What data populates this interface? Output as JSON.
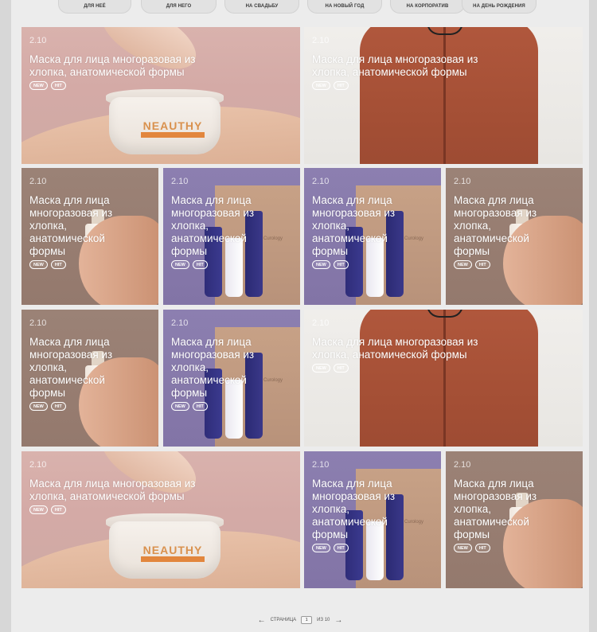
{
  "filters": [
    {
      "label": "ДЛЯ НЕЁ"
    },
    {
      "label": "ДЛЯ НЕГО"
    },
    {
      "label": "НА СВАДЬБУ"
    },
    {
      "label": "НА НОВЫЙ ГОД"
    },
    {
      "label": "НА КОРПОРАТИВ"
    },
    {
      "label": "НА ДЕНЬ РОЖДЕНИЯ"
    }
  ],
  "cards": [
    {
      "date": "2.10",
      "title": "Маска для лица многоразовая из хлопка, анатомической формы",
      "tags": [
        "NEW",
        "HIT"
      ],
      "photo": "jar"
    },
    {
      "date": "2.10",
      "title": "Маска для лица многоразовая из хлопка, анатомической формы",
      "tags": [
        "NEW",
        "HIT"
      ],
      "photo": "shirt"
    },
    {
      "date": "2.10",
      "title": "Маска для лица многоразовая из хлопка, анатомической формы",
      "tags": [
        "NEW",
        "HIT"
      ],
      "photo": "bottle"
    },
    {
      "date": "2.10",
      "title": "Маска для лица многоразовая из хлопка, анатомической формы",
      "tags": [
        "NEW",
        "HIT"
      ],
      "photo": "box"
    },
    {
      "date": "2.10",
      "title": "Маска для лица многоразовая из хлопка, анатомической формы",
      "tags": [
        "NEW",
        "HIT"
      ],
      "photo": "box"
    },
    {
      "date": "2.10",
      "title": "Маска для лица многоразовая из хлопка, анатомической формы",
      "tags": [
        "NEW",
        "HIT"
      ],
      "photo": "bottle"
    },
    {
      "date": "2.10",
      "title": "Маска для лица многоразовая из хлопка, анатомической формы",
      "tags": [
        "NEW",
        "HIT"
      ],
      "photo": "bottle"
    },
    {
      "date": "2.10",
      "title": "Маска для лица многоразовая из хлопка, анатомической формы",
      "tags": [
        "NEW",
        "HIT"
      ],
      "photo": "box"
    },
    {
      "date": "2.10",
      "title": "Маска для лица многоразовая из хлопка, анатомической формы",
      "tags": [
        "NEW",
        "HIT"
      ],
      "photo": "shirt"
    },
    {
      "date": "2.10",
      "title": "Маска для лица многоразовая из хлопка, анатомической формы",
      "tags": [
        "NEW",
        "HIT"
      ],
      "photo": "jar"
    },
    {
      "date": "2.10",
      "title": "Маска для лица многоразовая из хлопка, анатомической формы",
      "tags": [
        "NEW",
        "HIT"
      ],
      "photo": "box"
    },
    {
      "date": "2.10",
      "title": "Маска для лица многоразовая из хлопка, анатомической формы",
      "tags": [
        "NEW",
        "HIT"
      ],
      "photo": "bottle"
    }
  ],
  "photo_text": {
    "jar_brand": "NEAUTHY",
    "box_brand": "Curology"
  },
  "pagination": {
    "prev_icon": "arrow-left-icon",
    "label": "СТРАНИЦА",
    "current": "1",
    "of_label": "ИЗ 10",
    "next_icon": "arrow-right-icon"
  }
}
